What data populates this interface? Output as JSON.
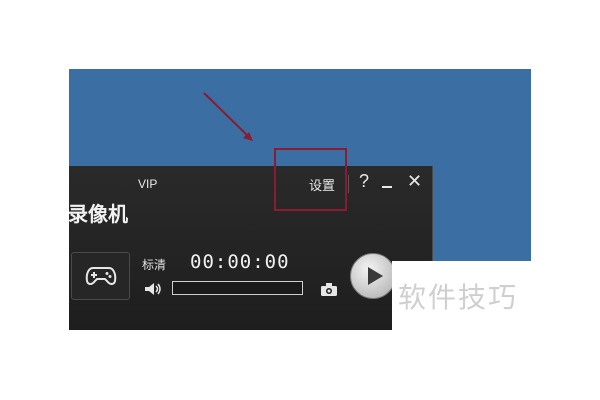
{
  "app": {
    "vip_label": "VIP",
    "settings_label": "设置",
    "help_label": "?",
    "close_label": "✕",
    "title": "录像机",
    "quality_label": "标清",
    "time": "00:00:00",
    "progress": 0
  },
  "watermark": "软件技巧",
  "colors": {
    "desktop": "#3b6ea3",
    "highlight": "#8b1a33",
    "app_bg": "#1e1e1e"
  },
  "icons": [
    "gamepad-icon",
    "volume-icon",
    "camera-icon",
    "play-icon",
    "minimize-icon",
    "close-icon",
    "help-icon"
  ]
}
